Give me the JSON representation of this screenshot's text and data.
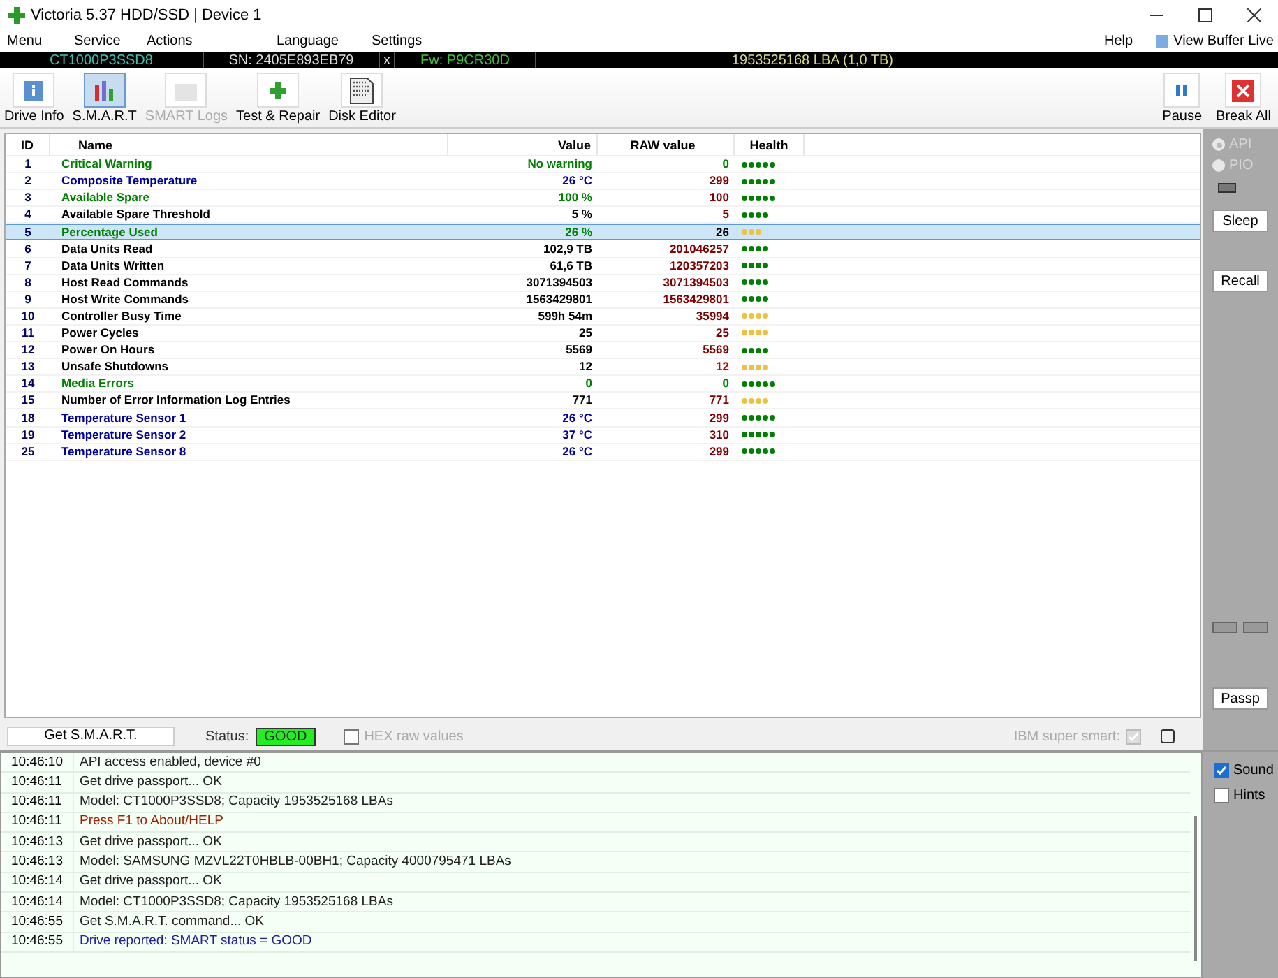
{
  "window": {
    "title": "Victoria 5.37 HDD/SSD | Device 1"
  },
  "menu": [
    "Menu",
    "Service",
    "Actions",
    "Language",
    "Settings"
  ],
  "menu_right": {
    "help": "Help",
    "view_buffer": "View Buffer Live"
  },
  "drive_bar": {
    "model": "CT1000P3SSD8",
    "serial": "SN: 2405E893EB79",
    "close": "x",
    "firmware": "Fw: P9CR30D",
    "capacity": "1953525168 LBA (1,0 TB)"
  },
  "toolbar": [
    {
      "label": "Drive Info",
      "kind": "info",
      "selected": false,
      "disabled": false
    },
    {
      "label": "S.M.A.R.T",
      "kind": "smart",
      "selected": true,
      "disabled": false
    },
    {
      "label": "SMART Logs",
      "kind": "logs",
      "selected": false,
      "disabled": true
    },
    {
      "label": "Test & Repair",
      "kind": "repair",
      "selected": false,
      "disabled": false
    },
    {
      "label": "Disk Editor",
      "kind": "editor",
      "selected": false,
      "disabled": false
    }
  ],
  "toolbar_right": [
    {
      "label": "Pause",
      "kind": "pause"
    },
    {
      "label": "Break All",
      "kind": "break"
    }
  ],
  "table": {
    "columns": [
      "ID",
      "Name",
      "Value",
      "RAW value",
      "Health"
    ],
    "rows": [
      {
        "id": "1",
        "name": "Critical Warning",
        "value": "No warning",
        "raw": {
          "text": "0",
          "color": "#008000"
        },
        "kind": "good",
        "health": {
          "stars": 5,
          "color": "#008000"
        },
        "selected": false
      },
      {
        "id": "2",
        "name": "Composite Temperature",
        "value": "26 °C",
        "raw": {
          "text": "299",
          "color": "#800000"
        },
        "kind": "temp",
        "health": {
          "stars": 5,
          "color": "#008000"
        },
        "selected": false
      },
      {
        "id": "3",
        "name": "Available Spare",
        "value": "100 %",
        "raw": {
          "text": "100",
          "color": "#800000"
        },
        "kind": "good",
        "health": {
          "stars": 5,
          "color": "#008000"
        },
        "selected": false
      },
      {
        "id": "4",
        "name": "Available Spare Threshold",
        "value": "5 %",
        "raw": {
          "text": "5",
          "color": "#800000"
        },
        "kind": "plain",
        "health": {
          "stars": 4,
          "color": "#008000"
        },
        "selected": false
      },
      {
        "id": "5",
        "name": "Percentage Used",
        "value": "26 %",
        "raw": {
          "text": "26",
          "color": "#000000"
        },
        "kind": "good",
        "health": {
          "stars": 3,
          "color": "#f0c040"
        },
        "selected": true
      },
      {
        "id": "6",
        "name": "Data Units Read",
        "value": "102,9 TB",
        "raw": {
          "text": "201046257",
          "color": "#800000"
        },
        "kind": "plain",
        "health": {
          "stars": 4,
          "color": "#008000"
        },
        "selected": false
      },
      {
        "id": "7",
        "name": "Data Units Written",
        "value": "61,6 TB",
        "raw": {
          "text": "120357203",
          "color": "#800000"
        },
        "kind": "plain",
        "health": {
          "stars": 4,
          "color": "#008000"
        },
        "selected": false
      },
      {
        "id": "8",
        "name": "Host Read Commands",
        "value": "3071394503",
        "raw": {
          "text": "3071394503",
          "color": "#800000"
        },
        "kind": "plain",
        "health": {
          "stars": 4,
          "color": "#008000"
        },
        "selected": false
      },
      {
        "id": "9",
        "name": "Host Write Commands",
        "value": "1563429801",
        "raw": {
          "text": "1563429801",
          "color": "#800000"
        },
        "kind": "plain",
        "health": {
          "stars": 4,
          "color": "#008000"
        },
        "selected": false
      },
      {
        "id": "10",
        "name": "Controller Busy Time",
        "value": "599h 54m",
        "raw": {
          "text": "35994",
          "color": "#800000"
        },
        "kind": "plain",
        "health": {
          "stars": 4,
          "color": "#f0c040"
        },
        "selected": false
      },
      {
        "id": "11",
        "name": "Power Cycles",
        "value": "25",
        "raw": {
          "text": "25",
          "color": "#800000"
        },
        "kind": "plain",
        "health": {
          "stars": 4,
          "color": "#f0c040"
        },
        "selected": false
      },
      {
        "id": "12",
        "name": "Power On Hours",
        "value": "5569",
        "raw": {
          "text": "5569",
          "color": "#800000"
        },
        "kind": "plain",
        "health": {
          "stars": 4,
          "color": "#008000"
        },
        "selected": false
      },
      {
        "id": "13",
        "name": "Unsafe Shutdowns",
        "value": "12",
        "raw": {
          "text": "12",
          "color": "#c00000"
        },
        "kind": "plain",
        "health": {
          "stars": 4,
          "color": "#f0c040"
        },
        "selected": false
      },
      {
        "id": "14",
        "name": "Media Errors",
        "value": "0",
        "raw": {
          "text": "0",
          "color": "#008000"
        },
        "kind": "good",
        "health": {
          "stars": 5,
          "color": "#008000"
        },
        "selected": false
      },
      {
        "id": "15",
        "name": "Number of Error Information Log Entries",
        "value": "771",
        "raw": {
          "text": "771",
          "color": "#800000"
        },
        "kind": "plain",
        "health": {
          "stars": 4,
          "color": "#f0c040"
        },
        "selected": false
      },
      {
        "id": "18",
        "name": "Temperature Sensor 1",
        "value": "26 °C",
        "raw": {
          "text": "299",
          "color": "#800000"
        },
        "kind": "temp",
        "health": {
          "stars": 5,
          "color": "#008000"
        },
        "selected": false
      },
      {
        "id": "19",
        "name": "Temperature Sensor 2",
        "value": "37 °C",
        "raw": {
          "text": "310",
          "color": "#800000"
        },
        "kind": "temp",
        "health": {
          "stars": 5,
          "color": "#008000"
        },
        "selected": false
      },
      {
        "id": "25",
        "name": "Temperature Sensor 8",
        "value": "26 °C",
        "raw": {
          "text": "299",
          "color": "#800000"
        },
        "kind": "temp",
        "health": {
          "stars": 5,
          "color": "#008000"
        },
        "selected": false
      }
    ]
  },
  "side_panel": {
    "modes": [
      {
        "label": "API",
        "selected": true
      },
      {
        "label": "PIO",
        "selected": false
      }
    ],
    "sleep": "Sleep",
    "recall": "Recall",
    "passp": "Passp"
  },
  "status_row": {
    "get_smart": "Get S.M.A.R.T.",
    "status_label": "Status:",
    "status": "GOOD",
    "hex_raw": {
      "label": "HEX raw values",
      "checked": false
    },
    "ibm": {
      "label": "IBM super smart:",
      "checked": true
    }
  },
  "log": [
    {
      "time": "10:46:10",
      "text": "API access enabled, device #0",
      "kind": "info"
    },
    {
      "time": "10:46:11",
      "text": "Get drive passport... OK",
      "kind": "info"
    },
    {
      "time": "10:46:11",
      "text": "Model: CT1000P3SSD8; Capacity 1953525168 LBAs",
      "kind": "info"
    },
    {
      "time": "10:46:11",
      "text": "Press F1 to About/HELP",
      "kind": "hint"
    },
    {
      "time": "10:46:13",
      "text": "Get drive passport... OK",
      "kind": "info"
    },
    {
      "time": "10:46:13",
      "text": "Model: SAMSUNG MZVL22T0HBLB-00BH1; Capacity 4000795471 LBAs",
      "kind": "info"
    },
    {
      "time": "10:46:14",
      "text": "Get drive passport... OK",
      "kind": "info"
    },
    {
      "time": "10:46:14",
      "text": "Model: CT1000P3SSD8; Capacity 1953525168 LBAs",
      "kind": "info"
    },
    {
      "time": "10:46:55",
      "text": "Get S.M.A.R.T. command... OK",
      "kind": "info"
    },
    {
      "time": "10:46:55",
      "text": "Drive reported: SMART status = GOOD",
      "kind": "result"
    }
  ],
  "log_options": [
    {
      "label": "Sound",
      "checked": true
    },
    {
      "label": "Hints",
      "checked": false
    }
  ]
}
